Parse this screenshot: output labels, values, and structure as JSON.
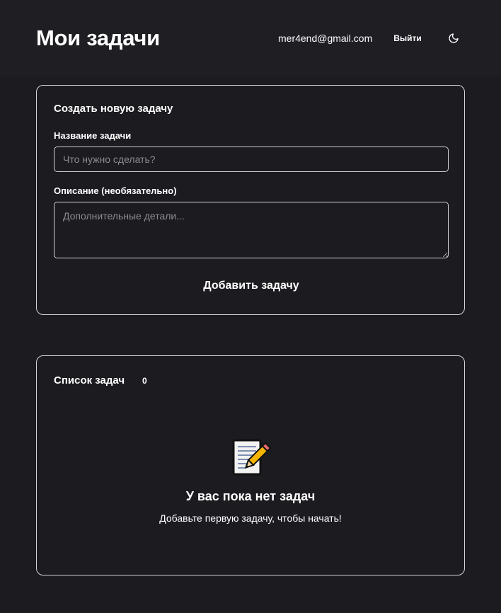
{
  "header": {
    "title": "Мои задачи",
    "user_email": "mer4end@gmail.com",
    "logout_label": "Выйти",
    "theme_icon": "moon-icon"
  },
  "create_form": {
    "heading": "Создать новую задачу",
    "title_label": "Название задачи",
    "title_placeholder": "Что нужно сделать?",
    "title_value": "",
    "description_label": "Описание (необязательно)",
    "description_placeholder": "Дополнительные детали...",
    "description_value": "",
    "submit_label": "Добавить задачу"
  },
  "task_list": {
    "heading": "Список задач",
    "count": "0",
    "empty_icon": "memo-icon",
    "empty_title": "У вас пока нет задач",
    "empty_subtitle": "Добавьте первую задачу, чтобы начать!"
  },
  "colors": {
    "background": "#1c1b20",
    "header_background": "#1f1e23",
    "border": "#d4d4d8",
    "text": "#ffffff",
    "placeholder": "#8b8b92"
  }
}
